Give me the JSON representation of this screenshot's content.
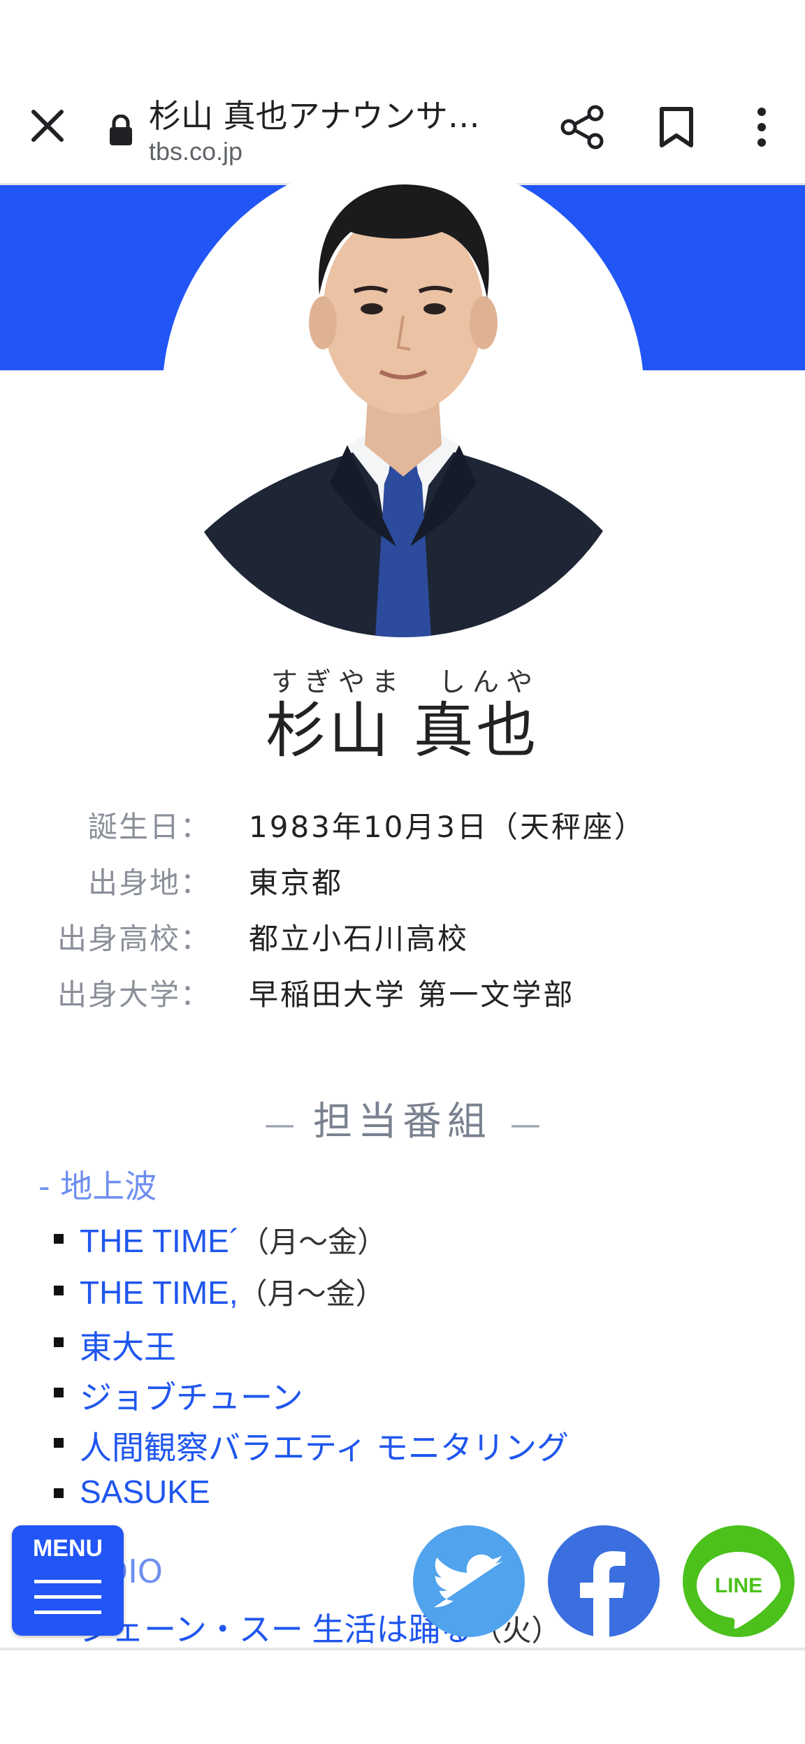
{
  "browser": {
    "title": "杉山 真也アナウンサ…",
    "url": "tbs.co.jp"
  },
  "profile": {
    "ruby_family": "すぎやま",
    "ruby_given": "しんや",
    "name": "杉山 真也",
    "rows": [
      {
        "label": "誕生日：",
        "value": "1983年10月3日（天秤座）"
      },
      {
        "label": "出身地：",
        "value": "東京都"
      },
      {
        "label": "出身高校：",
        "value": "都立小石川高校"
      },
      {
        "label": "出身大学：",
        "value": "早稲田大学 第一文学部"
      }
    ]
  },
  "programs": {
    "heading": "担当番組",
    "dash": "—",
    "categories": [
      {
        "label": "- 地上波"
      },
      {
        "label": "- RADIO"
      }
    ],
    "items": [
      {
        "title": "THE TIME´",
        "note": "（月〜金）"
      },
      {
        "title": "THE TIME,",
        "note": "（月〜金）"
      },
      {
        "title": "東大王",
        "note": ""
      },
      {
        "title": "ジョブチューン",
        "note": ""
      },
      {
        "title": "人間観察バラエティ モニタリング",
        "note": ""
      },
      {
        "title": "SASUKE",
        "note": ""
      },
      {
        "title": "ジェーン・スー 生活は踊る",
        "note": "（火）"
      }
    ]
  },
  "floating": {
    "menu_label": "MENU",
    "line_label": "LINE"
  },
  "colors": {
    "brand_blue": "#2255f5",
    "link_blue": "#1f56ee",
    "twitter": "#50a3ec",
    "facebook": "#3b6fe0",
    "line": "#4cc11c"
  }
}
